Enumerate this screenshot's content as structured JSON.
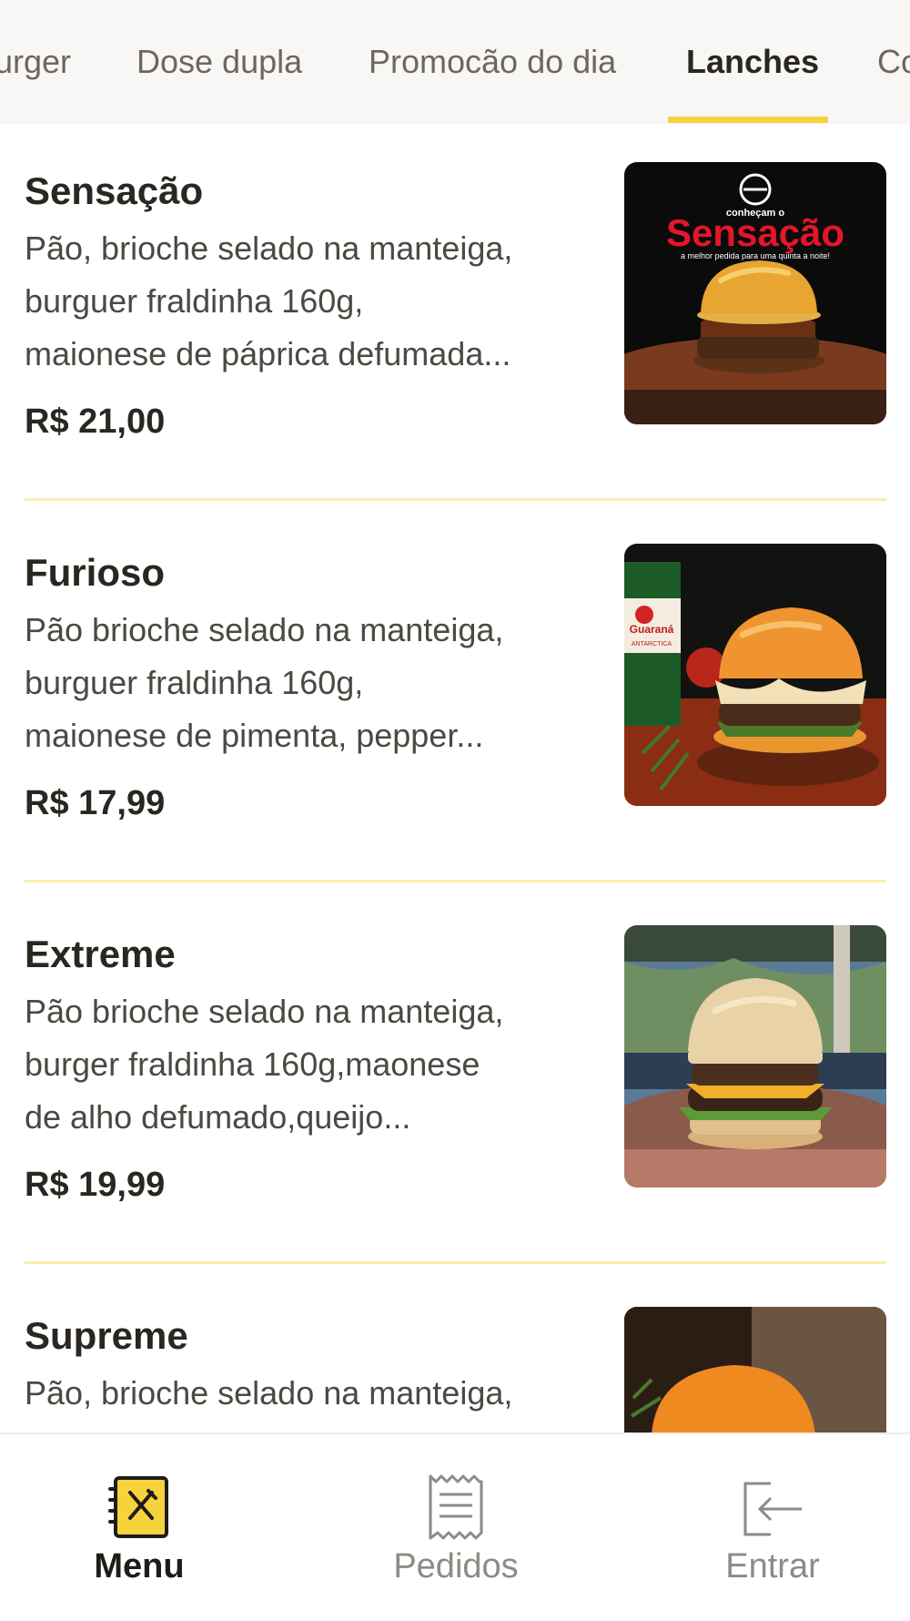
{
  "tabs": [
    {
      "label": "urger",
      "active": false
    },
    {
      "label": "Dose dupla",
      "active": false
    },
    {
      "label": "Promocão do dia",
      "active": false
    },
    {
      "label": "Lanches",
      "active": true
    },
    {
      "label": "Co",
      "active": false
    }
  ],
  "products": [
    {
      "name": "Sensação",
      "description_lines": [
        "Pão, brioche selado na manteiga,",
        "burguer fraldinha 160g,",
        "maionese de páprica defumada..."
      ],
      "price": "R$ 21,00",
      "image": {
        "type": "photo-burger-poster",
        "logo_text": "conheçam o",
        "headline": "Sensação",
        "tagline": "a melhor pedida para uma quinta a noite!"
      }
    },
    {
      "name": "Furioso",
      "description_lines": [
        "Pão brioche selado na manteiga,",
        "burguer fraldinha 160g,",
        "maionese de pimenta, pepper..."
      ],
      "price": "R$ 17,99",
      "image": {
        "type": "photo-burger-with-can",
        "can_text": "Guaraná",
        "can_subtext": "ANTARCTICA"
      }
    },
    {
      "name": "Extreme",
      "description_lines": [
        "Pão brioche selado na manteiga,",
        "burger fraldinha 160g,maonese",
        "de alho defumado,queijo..."
      ],
      "price": "R$ 19,99",
      "image": {
        "type": "photo-burger-outdoor"
      }
    },
    {
      "name": "Supreme",
      "description_lines": [
        "Pão, brioche selado na manteiga,"
      ],
      "price": "",
      "image": {
        "type": "photo-burger-dark"
      }
    }
  ],
  "nav": [
    {
      "label": "Menu",
      "icon": "menu-book-icon",
      "active": true
    },
    {
      "label": "Pedidos",
      "icon": "receipt-icon",
      "active": false
    },
    {
      "label": "Entrar",
      "icon": "login-icon",
      "active": false
    }
  ],
  "colors": {
    "accent": "#f6d23d",
    "text": "#2a2620",
    "muted": "#8e8a84",
    "divider": "#fbeea8"
  }
}
